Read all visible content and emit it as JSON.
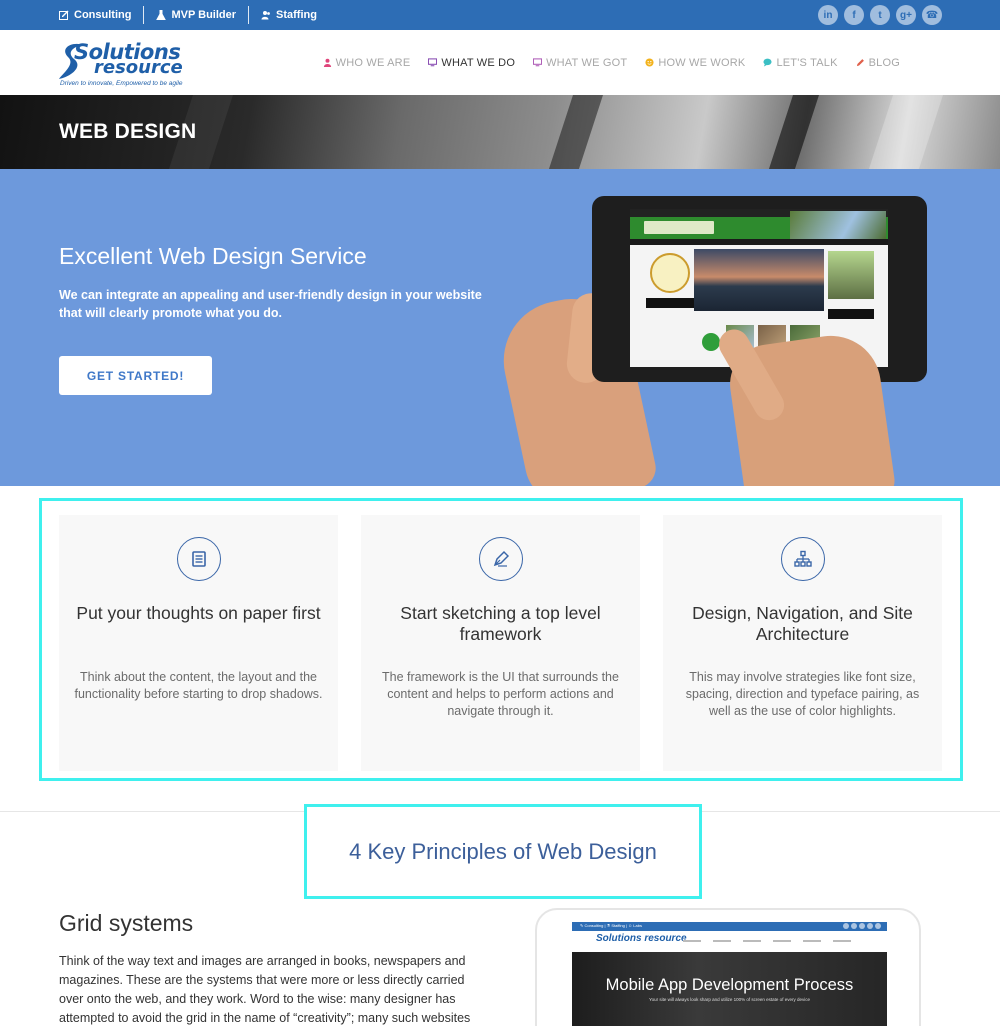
{
  "topbar": {
    "links": [
      {
        "label": "Consulting",
        "icon": "edit-icon"
      },
      {
        "label": "MVP Builder",
        "icon": "flask-icon"
      },
      {
        "label": "Staffing",
        "icon": "users-icon"
      }
    ],
    "social": [
      {
        "icon": "linkedin-icon",
        "glyph": "in"
      },
      {
        "icon": "facebook-icon",
        "glyph": "f"
      },
      {
        "icon": "twitter-icon",
        "glyph": "t"
      },
      {
        "icon": "google-plus-icon",
        "glyph": "g+"
      },
      {
        "icon": "phone-icon",
        "glyph": "☎"
      }
    ]
  },
  "logo": {
    "line1": "Solutions",
    "line2": "resource",
    "tagline": "Driven to innovate, Empowered to be agile"
  },
  "nav": {
    "items": [
      {
        "label": "WHO WE ARE",
        "icon": "person-icon",
        "icon_color": "#e0457b"
      },
      {
        "label": "WHAT WE DO",
        "icon": "monitor-icon",
        "icon_color": "#8a4fb3",
        "active": true
      },
      {
        "label": "WHAT WE GOT",
        "icon": "monitor-icon",
        "icon_color": "#b05fb8"
      },
      {
        "label": "HOW WE WORK",
        "icon": "smiley-icon",
        "icon_color": "#f3b21b"
      },
      {
        "label": "LET'S TALK",
        "icon": "chat-icon",
        "icon_color": "#3bbfc4"
      },
      {
        "label": "BLOG",
        "icon": "pencil-icon",
        "icon_color": "#e0604b"
      }
    ]
  },
  "page_title": "WEB DESIGN",
  "hero": {
    "heading": "Excellent Web Design Service",
    "text": "We can integrate an appealing and user-friendly design in your website that will clearly promote what you do.",
    "button": "GET STARTED!"
  },
  "features": [
    {
      "icon": "document-icon",
      "title": "Put your thoughts on paper first",
      "text": "Think about the content, the layout and the functionality before starting to drop shadows."
    },
    {
      "icon": "pen-nib-icon",
      "title": "Start sketching a top level framework",
      "text": "The framework is the UI that surrounds the content and helps to perform actions and navigate through it."
    },
    {
      "icon": "sitemap-icon",
      "title": "Design, Navigation, and Site Architecture",
      "text": "This may involve strategies like font size, spacing, direction and typeface pairing, as well as the use of color highlights."
    }
  ],
  "principles_heading": "4 Key Principles of Web Design",
  "grid_section": {
    "title": "Grid systems",
    "text": "Think of the way text and images are arranged in books, newspapers and magazines. These are the systems that were more or less directly carried over onto the web, and they work. Word to the wise: many designer has attempted to avoid the grid in the name of “creativity”; many such websites"
  },
  "device_screen": {
    "top_links": "✎ Consulting  |  ⚗ Staffing  |  ☺ Labs",
    "logo": "Solutions resource",
    "hero_title": "Mobile App Development Process",
    "hero_sub": "Your site will always look sharp and utilize 100% of screen estate of every device",
    "prev": "‹",
    "next": "›"
  },
  "colors": {
    "topbar": "#2d6db5",
    "hero_bg": "#6d99dc",
    "highlight_outline": "#3ff0ee",
    "accent_text": "#3c5f9a"
  }
}
